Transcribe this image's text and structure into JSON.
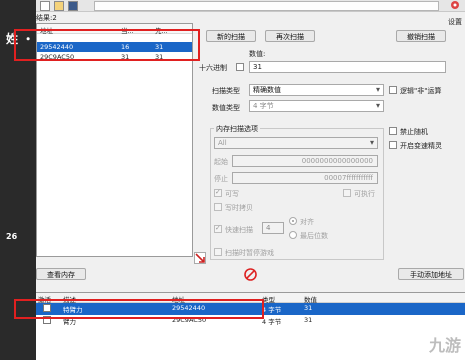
{
  "left_overlay": {
    "t1": "姓 ・",
    "t2": "26"
  },
  "results_count": "结果:2",
  "address_list": {
    "headers": [
      "地址",
      "当...",
      "先..."
    ],
    "rows": [
      {
        "address": "29542440",
        "current": "16",
        "previous": "31"
      },
      {
        "address": "29C9AC50",
        "current": "31",
        "previous": "31"
      }
    ]
  },
  "buttons": {
    "new_scan": "新的扫描",
    "next_scan": "再次扫描",
    "undo_scan": "撤销扫描",
    "settings": "设置",
    "view_memory": "查看内存",
    "add_address": "手动添加地址"
  },
  "value": {
    "label": "数值:",
    "hex_label": "十六进制",
    "input": "31"
  },
  "scan_type": {
    "label": "扫描类型",
    "value": "精确数值"
  },
  "value_type": {
    "label": "数值类型",
    "value": "4 字节"
  },
  "logic_not": "逻辑\"非\"运算",
  "memory_options": {
    "title": "内存扫描选项",
    "region": "All",
    "start_label": "起始",
    "start_value": "0000000000000000",
    "stop_label": "停止",
    "stop_value": "00007fffffffffff",
    "writable": "可写",
    "executable": "可执行",
    "copy_on_write": "写时拷贝",
    "fast_scan": "快速扫描",
    "fast_scan_value": "4",
    "align": "对齐",
    "last_digits": "最后位数",
    "pause_game": "扫描时暂停游戏"
  },
  "disable_random": "禁止随机",
  "enable_speedhack": "开启变速精灵",
  "cheat_table": {
    "headers": [
      "激活",
      "描述",
      "地址",
      "类型",
      "数值"
    ],
    "rows": [
      {
        "desc": "特臂力",
        "address": "29542440",
        "type": "4 字节",
        "value": "31"
      },
      {
        "desc": "臂力",
        "address": "29C9AC50",
        "type": "4 字节",
        "value": "31"
      }
    ]
  },
  "watermark": "九游"
}
